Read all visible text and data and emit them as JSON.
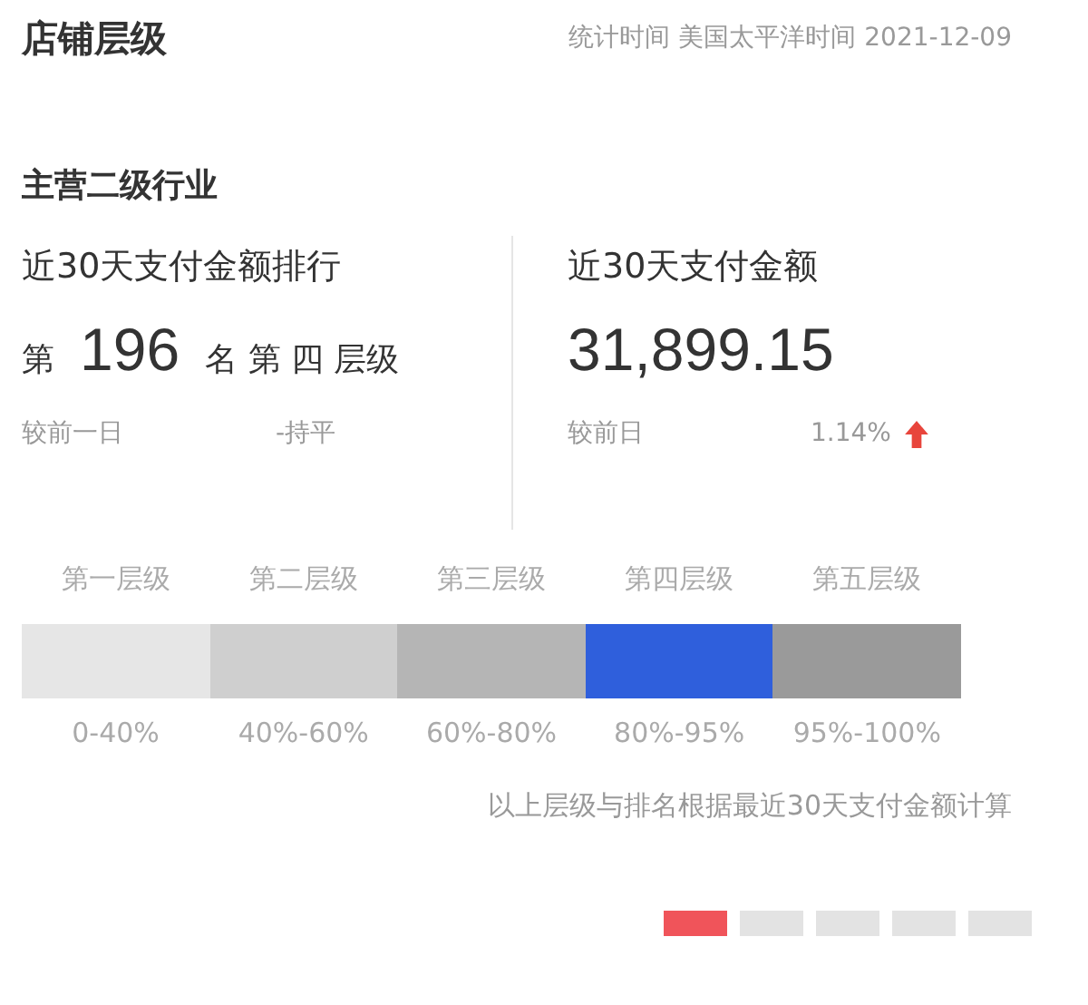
{
  "header": {
    "title": "店铺层级",
    "stat_time": "统计时间 美国太平洋时间 2021-12-09"
  },
  "section_title": "主营二级行业",
  "rank": {
    "label": "近30天支付金额排行",
    "prefix": "第",
    "number": "196",
    "suffix": "名 第 四 层级",
    "compare_label": "较前一日",
    "compare_value": "-持平"
  },
  "amount": {
    "label": "近30天支付金额",
    "value": "31,899.15",
    "compare_label": "较前日",
    "compare_value": "1.14%",
    "kind": "up"
  },
  "tiers": [
    {
      "name": "第一层级",
      "range": "0-40%",
      "color": "#e6e6e6"
    },
    {
      "name": "第二层级",
      "range": "40%-60%",
      "color": "#cfcfcf"
    },
    {
      "name": "第三层级",
      "range": "60%-80%",
      "color": "#b5b5b5"
    },
    {
      "name": "第四层级",
      "range": "80%-95%",
      "color": "#2f5fdc"
    },
    {
      "name": "第五层级",
      "range": "95%-100%",
      "color": "#9a9a9a"
    }
  ],
  "note": "以上层级与排名根据最近30天支付金额计算",
  "pager": [
    {
      "selected": true
    },
    {
      "selected": false
    },
    {
      "selected": false
    },
    {
      "selected": false
    },
    {
      "selected": false
    }
  ]
}
